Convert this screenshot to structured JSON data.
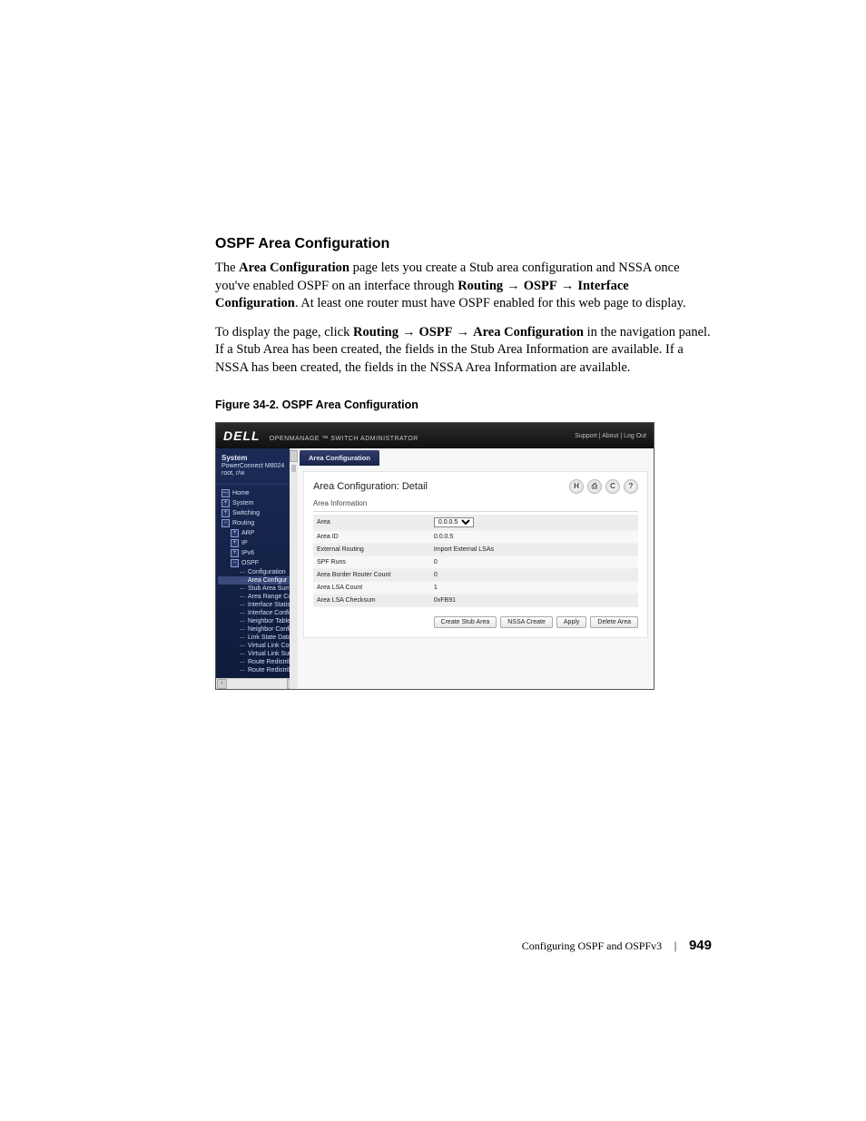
{
  "section_title": "OSPF Area Configuration",
  "para1": {
    "t1": "The ",
    "b1": "Area Configuration",
    "t2": " page lets you create a Stub area configuration and NSSA once you've enabled OSPF on an interface through ",
    "b2": "Routing",
    "arr1": " → ",
    "b3": "OSPF",
    "arr2": " → ",
    "b4": "Interface Configuration",
    "t3": ". At least one router must have OSPF enabled for this web page to display."
  },
  "para2": {
    "t1": "To display the page, click ",
    "b1": "Routing",
    "arr1": " → ",
    "b2": "OSPF",
    "arr2": " → ",
    "b3": "Area Configuration",
    "t2": " in the navigation panel. If a Stub Area has been created, the fields in the Stub Area Information are available. If a NSSA has been created, the fields in the NSSA Area Information are available."
  },
  "figure_caption": "Figure 34-2.    OSPF Area Configuration",
  "screenshot": {
    "logo": "DELL",
    "brand": "OPENMANAGE ™ SWITCH ADMINISTRATOR",
    "toplinks": "Support  |  About  |  Log Out",
    "side": {
      "system": "System",
      "model": "PowerConnect M8024",
      "user": "root, r/w",
      "tree": [
        {
          "lv": 1,
          "box": "—",
          "label": "Home"
        },
        {
          "lv": 1,
          "box": "+",
          "label": "System"
        },
        {
          "lv": 1,
          "box": "+",
          "label": "Switching"
        },
        {
          "lv": 1,
          "box": "−",
          "label": "Routing"
        },
        {
          "lv": 2,
          "box": "+",
          "label": "ARP"
        },
        {
          "lv": 2,
          "box": "+",
          "label": "IP"
        },
        {
          "lv": 2,
          "box": "+",
          "label": "IPv6"
        },
        {
          "lv": 2,
          "box": "−",
          "label": "OSPF"
        },
        {
          "lv": 3,
          "box": "",
          "label": "Configuration"
        },
        {
          "lv": 3,
          "box": "",
          "label": "Area Configur",
          "hl": true
        },
        {
          "lv": 3,
          "box": "",
          "label": "Stub Area Summ"
        },
        {
          "lv": 3,
          "box": "",
          "label": "Area Range Con"
        },
        {
          "lv": 3,
          "box": "",
          "label": "Interface Statisti"
        },
        {
          "lv": 3,
          "box": "",
          "label": "Interface Config"
        },
        {
          "lv": 3,
          "box": "",
          "label": "Neighbor Table"
        },
        {
          "lv": 3,
          "box": "",
          "label": "Neighbor Config"
        },
        {
          "lv": 3,
          "box": "",
          "label": "Link State Datab"
        },
        {
          "lv": 3,
          "box": "",
          "label": "Virtual Link Conf"
        },
        {
          "lv": 3,
          "box": "",
          "label": "Virtual Link Sum"
        },
        {
          "lv": 3,
          "box": "",
          "label": "Route Redistrib"
        },
        {
          "lv": 3,
          "box": "",
          "label": "Route Redistrib"
        }
      ]
    },
    "tab_label": "Area Configuration",
    "panel_title": "Area Configuration: Detail",
    "icons": {
      "save": "H",
      "print": "⎙",
      "refresh": "C",
      "help": "?"
    },
    "subhead": "Area Information",
    "rows": [
      {
        "k": "Area",
        "v": "0.0.0.5",
        "select": true
      },
      {
        "k": "Area ID",
        "v": "0.0.0.5"
      },
      {
        "k": "External Routing",
        "v": "Import External LSAs"
      },
      {
        "k": "SPF Runs",
        "v": "0"
      },
      {
        "k": "Area Border Router Count",
        "v": "0"
      },
      {
        "k": "Area LSA Count",
        "v": "1"
      },
      {
        "k": "Area LSA Checksum",
        "v": "0xFB91"
      }
    ],
    "buttons": [
      "Create Stub Area",
      "NSSA Create",
      "Apply",
      "Delete Area"
    ]
  },
  "footer": {
    "chapter": "Configuring OSPF and OSPFv3",
    "page": "949"
  }
}
